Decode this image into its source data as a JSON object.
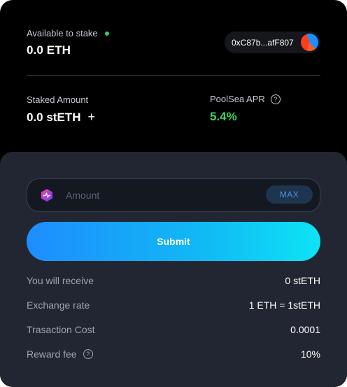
{
  "stake": {
    "available_label": "Available to stake",
    "available_value": "0.0 ETH",
    "wallet_address": "0xC87b...afF807",
    "staked_label": "Staked Amount",
    "staked_value": "0.0 stETH",
    "add_symbol": "+",
    "apr_label": "PoolSea APR",
    "apr_value": "5.4%",
    "help_symbol": "?"
  },
  "form": {
    "amount_placeholder": "Amount",
    "max_label": "MAX",
    "submit_label": "Submit"
  },
  "details": [
    {
      "label": "You will receive",
      "value": "0 stETH"
    },
    {
      "label": "Exchange rate",
      "value": "1 ETH = 1stETH"
    },
    {
      "label": "Trasaction Cost",
      "value": "0.0001"
    },
    {
      "label": "Reward fee",
      "value": "10%"
    }
  ],
  "colors": {
    "accent": "#1e8dff",
    "apr_green": "#3ad36b",
    "status_dot": "#2fd06b",
    "panel_bg": "#222632"
  },
  "icons": [
    "status-dot",
    "wallet-avatar-icon",
    "help-icon",
    "plus-icon",
    "token-icon"
  ]
}
